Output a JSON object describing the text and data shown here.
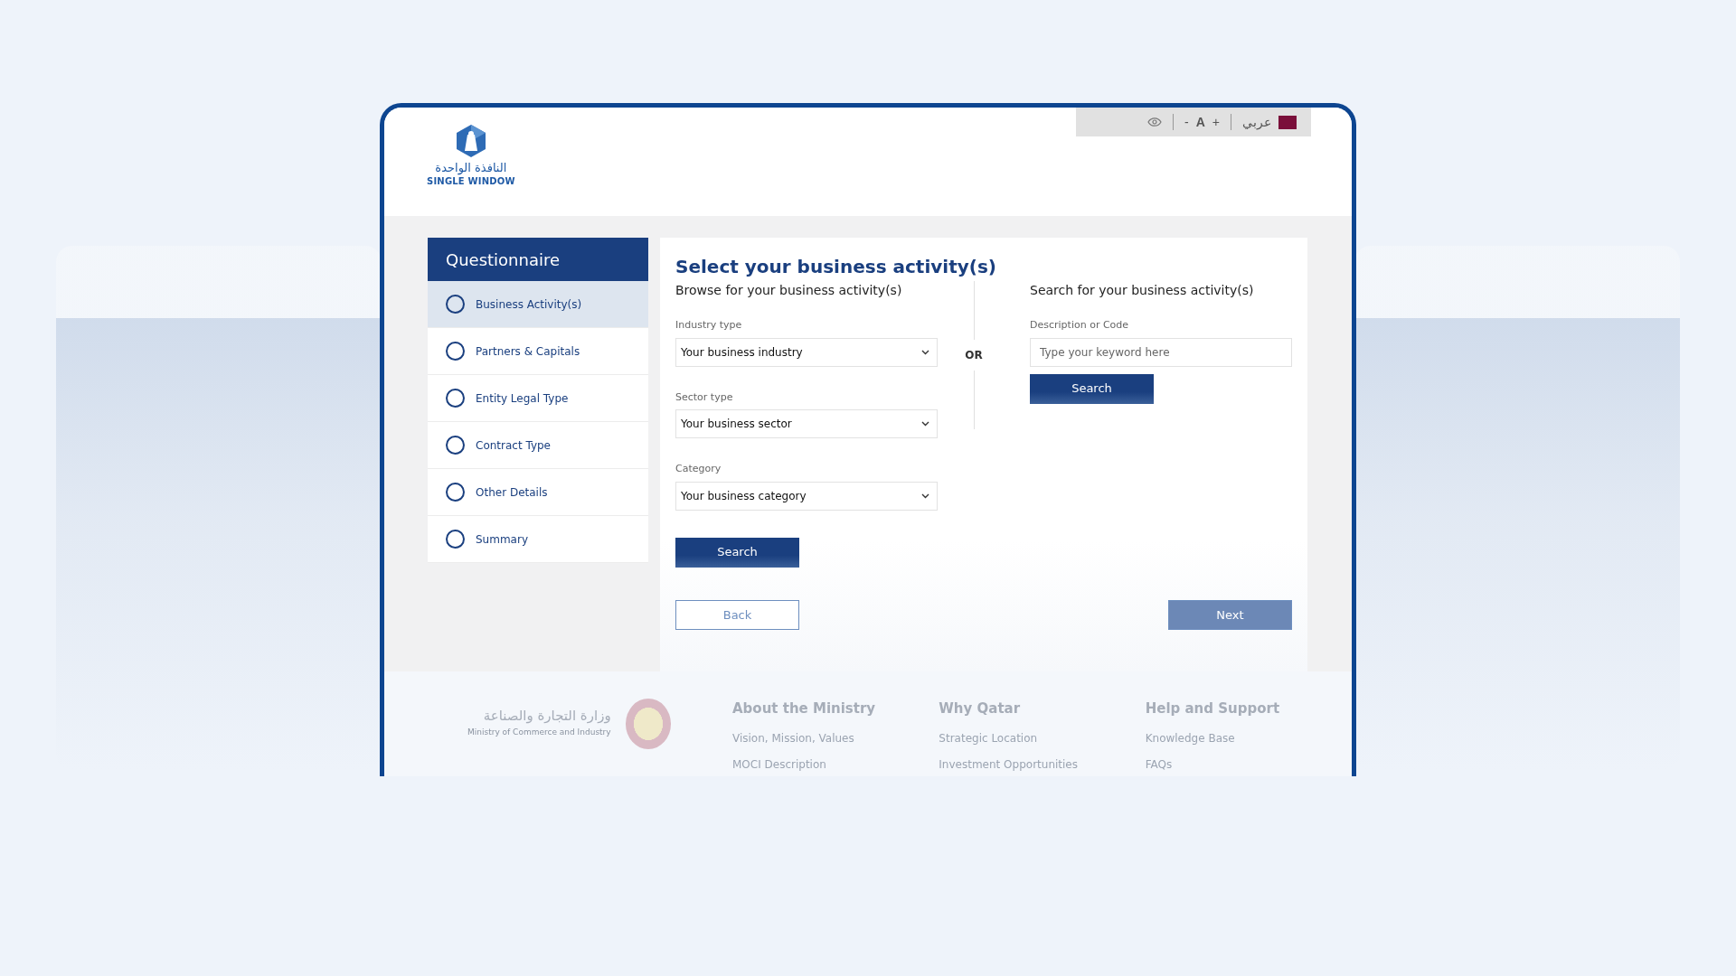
{
  "topbar": {
    "font_decrease": "-",
    "font_label": "A",
    "font_increase": "+",
    "language": "عربي"
  },
  "logo": {
    "arabic": "النافذة الواحدة",
    "english": "SINGLE WINDOW"
  },
  "sidebar": {
    "title": "Questionnaire",
    "items": [
      {
        "label": "Business Activity(s)",
        "selected": true,
        "checked": false
      },
      {
        "label": "Partners & Capitals",
        "selected": false,
        "checked": false
      },
      {
        "label": "Entity Legal Type",
        "selected": false,
        "checked": false
      },
      {
        "label": "Contract Type",
        "selected": false,
        "checked": false
      },
      {
        "label": "Other Details",
        "selected": false,
        "checked": false
      },
      {
        "label": "Summary",
        "selected": false,
        "checked": false
      }
    ]
  },
  "form": {
    "title": "Select your business activity(s)",
    "browse": {
      "heading": "Browse for your business activity(s)",
      "fields": [
        {
          "label": "Industry type",
          "value": "Your business industry"
        },
        {
          "label": "Sector type",
          "value": "Your business sector"
        },
        {
          "label": "Category",
          "value": "Your business category"
        }
      ],
      "button": "Search"
    },
    "separator": "OR",
    "search": {
      "heading": "Search for your business activity(s)",
      "field": {
        "label": "Description or Code",
        "placeholder": "Type your keyword here"
      },
      "button": "Search"
    },
    "back": {
      "label": "Back",
      "disabled": false
    },
    "next": {
      "label": "Next",
      "disabled": true
    }
  },
  "footer": {
    "ministry": {
      "arabic": "وزارة التجارة والصناعة",
      "english": "Ministry of Commerce and Industry"
    },
    "columns": [
      {
        "heading": "About the Ministry",
        "links": [
          "Vision, Mission, Values",
          "MOCI Description"
        ]
      },
      {
        "heading": "Why Qatar",
        "links": [
          "Strategic Location",
          "Investment Opportunities"
        ]
      },
      {
        "heading": "Help and Support",
        "links": [
          "Knowledge Base",
          "FAQs"
        ]
      }
    ]
  }
}
